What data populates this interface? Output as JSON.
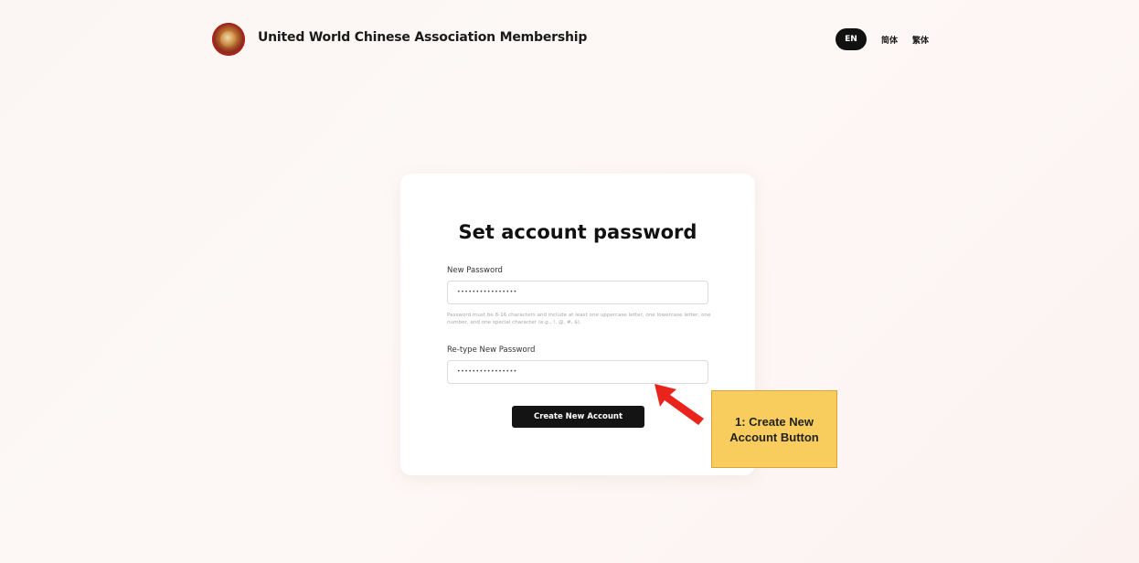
{
  "header": {
    "brand_title": "United World Chinese Association Membership",
    "languages": [
      {
        "label": "EN",
        "active": true
      },
      {
        "label": "简体",
        "active": false
      },
      {
        "label": "繁体",
        "active": false
      }
    ]
  },
  "form": {
    "title": "Set account password",
    "new_password": {
      "label": "New Password",
      "value": "••••••••••••••••"
    },
    "helper_text": "Password must be 8-16 characters and include at least one uppercase letter, one lowercase letter, one number, and one special character (e.g., !, @, #, $).",
    "retype_password": {
      "label": "Re-type New Password",
      "value": "••••••••••••••••"
    },
    "submit_label": "Create New Account"
  },
  "annotation": {
    "note_text": "1: Create New Account  Button",
    "arrow_color": "#e8241c",
    "note_color": "#f8cd5e"
  },
  "colors": {
    "button_bg": "#141414",
    "active_lang_bg": "#111111"
  }
}
